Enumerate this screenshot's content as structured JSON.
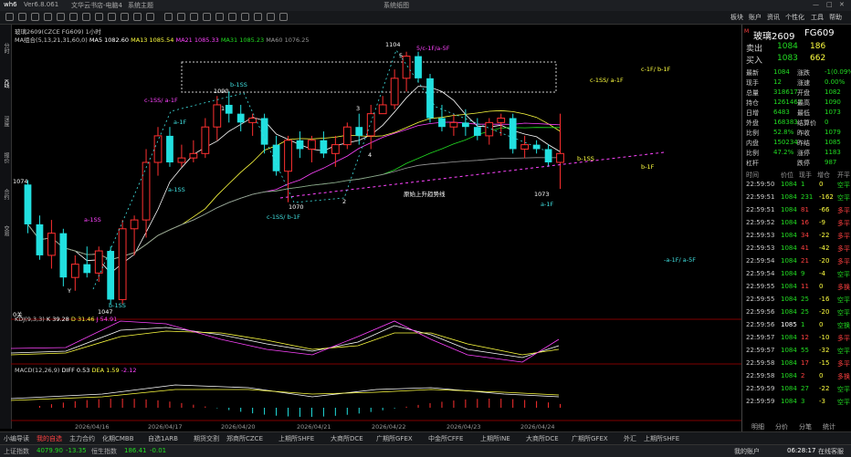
{
  "titlebar": {
    "logo": "wh6",
    "version": "Ver6.8.061",
    "menu": [
      "文华云书店-电脑4",
      "系统主题"
    ],
    "window_title": "系统纸图"
  },
  "toolbar": {
    "right_items": [
      "板块",
      "账户",
      "资讯",
      "个性化",
      "工具",
      "帮助"
    ]
  },
  "leftbar": {
    "items": [
      "分时",
      "K线",
      "深度",
      "报价",
      "合约",
      "交易"
    ]
  },
  "chart": {
    "title_line": "玻璃2609(CZCE FG609)   1小时",
    "ma_legend": [
      {
        "text": "MA组合(5,13,21,31,60,0)",
        "color": "#cccccc"
      },
      {
        "text": "MA5 1082.60",
        "color": "#ffffff"
      },
      {
        "text": "MA13 1085.54",
        "color": "#ffff40"
      },
      {
        "text": "MA21 1085.33",
        "color": "#ff44ff"
      },
      {
        "text": "MA31 1085.23",
        "color": "#22dd22"
      },
      {
        "text": "MA60 1076.25",
        "color": "#999999"
      }
    ],
    "price_labels": {
      "high": "1104",
      "low": "1047",
      "left_level": "1074",
      "mid_low": "1070",
      "right_low": "1073",
      "top_mid": "1090"
    },
    "wave_labels": [
      "c-1SS/ a-1F",
      "b-1SS",
      "a-1SS",
      "a-1SS",
      "b-1SS",
      "c-1SS/ b-1F",
      "5/c-1F/a-5F",
      "c-1SS/ a-1F",
      "c-1F/ b-1F",
      "b-1SS",
      "b-1F",
      "a-1F",
      "-a-1F/ a-5F",
      "a-1F",
      "原始上升趋势线",
      "Y",
      "1",
      "2",
      "3",
      "4",
      "5"
    ],
    "kdj_legend": {
      "name": "KDJ(9,3,3)",
      "k": "K 39.28",
      "d": "D 31.46",
      "j": "J 54.91"
    },
    "macd_legend": {
      "name": "MACD(12,26,9)",
      "diff": "DIFF 0.53",
      "dea": "DEA 1.59",
      "macd": "-2.12"
    },
    "vol_label": "0关",
    "dates": [
      "2026/04/16",
      "2026/04/17",
      "2026/04/20",
      "2026/04/21",
      "2026/04/22",
      "2026/04/23",
      "2026/04/24"
    ]
  },
  "chart_data": {
    "type": "candlestick",
    "title": "玻璃2609(CZCE FG609)",
    "ylim": [
      1045,
      1106
    ],
    "candles": [
      {
        "o": 1074,
        "h": 1075,
        "l": 1063,
        "c": 1065
      },
      {
        "o": 1065,
        "h": 1067,
        "l": 1057,
        "c": 1058
      },
      {
        "o": 1058,
        "h": 1066,
        "l": 1055,
        "c": 1063
      },
      {
        "o": 1063,
        "h": 1064,
        "l": 1051,
        "c": 1053
      },
      {
        "o": 1053,
        "h": 1058,
        "l": 1050,
        "c": 1056
      },
      {
        "o": 1056,
        "h": 1060,
        "l": 1053,
        "c": 1054
      },
      {
        "o": 1054,
        "h": 1060,
        "l": 1052,
        "c": 1059
      },
      {
        "o": 1059,
        "h": 1060,
        "l": 1047,
        "c": 1048
      },
      {
        "o": 1048,
        "h": 1066,
        "l": 1047,
        "c": 1064
      },
      {
        "o": 1064,
        "h": 1067,
        "l": 1058,
        "c": 1066
      },
      {
        "o": 1066,
        "h": 1082,
        "l": 1062,
        "c": 1079
      },
      {
        "o": 1079,
        "h": 1087,
        "l": 1076,
        "c": 1085
      },
      {
        "o": 1085,
        "h": 1087,
        "l": 1078,
        "c": 1079
      },
      {
        "o": 1079,
        "h": 1083,
        "l": 1078,
        "c": 1080
      },
      {
        "o": 1080,
        "h": 1084,
        "l": 1079,
        "c": 1081
      },
      {
        "o": 1081,
        "h": 1089,
        "l": 1080,
        "c": 1087
      },
      {
        "o": 1087,
        "h": 1094,
        "l": 1084,
        "c": 1092
      },
      {
        "o": 1092,
        "h": 1095,
        "l": 1088,
        "c": 1090
      },
      {
        "o": 1090,
        "h": 1092,
        "l": 1086,
        "c": 1088
      },
      {
        "o": 1088,
        "h": 1090,
        "l": 1085,
        "c": 1089
      },
      {
        "o": 1089,
        "h": 1090,
        "l": 1081,
        "c": 1083
      },
      {
        "o": 1083,
        "h": 1085,
        "l": 1076,
        "c": 1077
      },
      {
        "o": 1077,
        "h": 1085,
        "l": 1070,
        "c": 1084
      },
      {
        "o": 1084,
        "h": 1086,
        "l": 1080,
        "c": 1082
      },
      {
        "o": 1082,
        "h": 1085,
        "l": 1079,
        "c": 1084
      },
      {
        "o": 1084,
        "h": 1086,
        "l": 1080,
        "c": 1081
      },
      {
        "o": 1081,
        "h": 1085,
        "l": 1078,
        "c": 1083
      },
      {
        "o": 1083,
        "h": 1088,
        "l": 1082,
        "c": 1087
      },
      {
        "o": 1087,
        "h": 1090,
        "l": 1083,
        "c": 1085
      },
      {
        "o": 1085,
        "h": 1092,
        "l": 1082,
        "c": 1090
      },
      {
        "o": 1090,
        "h": 1094,
        "l": 1090,
        "c": 1092
      },
      {
        "o": 1092,
        "h": 1100,
        "l": 1091,
        "c": 1098
      },
      {
        "o": 1098,
        "h": 1104,
        "l": 1095,
        "c": 1103
      },
      {
        "o": 1103,
        "h": 1104,
        "l": 1097,
        "c": 1098
      },
      {
        "o": 1098,
        "h": 1099,
        "l": 1088,
        "c": 1089
      },
      {
        "o": 1089,
        "h": 1092,
        "l": 1086,
        "c": 1087
      },
      {
        "o": 1087,
        "h": 1090,
        "l": 1085,
        "c": 1088
      },
      {
        "o": 1088,
        "h": 1091,
        "l": 1085,
        "c": 1087
      },
      {
        "o": 1087,
        "h": 1089,
        "l": 1084,
        "c": 1085
      },
      {
        "o": 1085,
        "h": 1089,
        "l": 1083,
        "c": 1088
      },
      {
        "o": 1088,
        "h": 1090,
        "l": 1085,
        "c": 1089
      },
      {
        "o": 1089,
        "h": 1090,
        "l": 1081,
        "c": 1082
      },
      {
        "o": 1082,
        "h": 1085,
        "l": 1080,
        "c": 1083
      },
      {
        "o": 1083,
        "h": 1084,
        "l": 1081,
        "c": 1082
      },
      {
        "o": 1082,
        "h": 1083,
        "l": 1078,
        "c": 1079
      },
      {
        "o": 1079,
        "h": 1090,
        "l": 1073,
        "c": 1081
      }
    ]
  },
  "quote": {
    "header_name": "玻璃2609",
    "header_code": "FG609",
    "sell": {
      "label": "卖出",
      "price": "1084",
      "vol": "186"
    },
    "buy": {
      "label": "买入",
      "price": "1083",
      "vol": "662"
    },
    "stats": [
      [
        "最新",
        "1084",
        "涨跌",
        "-1(0.09%"
      ],
      [
        "现手",
        "12",
        "涨速",
        "0.00%"
      ],
      [
        "总量",
        "318617",
        "开盘",
        "1082"
      ],
      [
        "持仓",
        "1261467",
        "最高",
        "1090"
      ],
      [
        "日增",
        "6483",
        "最低",
        "1073"
      ],
      [
        "外盘",
        "168383",
        "结算价",
        "0"
      ],
      [
        "比例",
        "52.8%",
        "昨收",
        "1079"
      ],
      [
        "内盘",
        "150234",
        "昨结",
        "1085"
      ],
      [
        "比例",
        "47.2%",
        "涨停",
        "1183"
      ],
      [
        "杠杆",
        "",
        "跌停",
        "987"
      ]
    ],
    "ticks_header": [
      "时间",
      "价位",
      "现手",
      "增仓",
      "开平"
    ],
    "ticks": [
      [
        "22:59:50",
        "1084",
        "1",
        "0",
        "空平"
      ],
      [
        "22:59:51",
        "1084",
        "231",
        "-162",
        "空平"
      ],
      [
        "22:59:51",
        "1084",
        "81",
        "-66",
        "多平"
      ],
      [
        "22:59:52",
        "1084",
        "16",
        "-9",
        "多平"
      ],
      [
        "22:59:53",
        "1084",
        "34",
        "-22",
        "多平"
      ],
      [
        "22:59:53",
        "1084",
        "41",
        "-42",
        "多平"
      ],
      [
        "22:59:54",
        "1084",
        "21",
        "-20",
        "多平"
      ],
      [
        "22:59:54",
        "1084",
        "9",
        "-4",
        "空平"
      ],
      [
        "22:59:55",
        "1084",
        "11",
        "0",
        "多换"
      ],
      [
        "22:59:55",
        "1084",
        "25",
        "-16",
        "空平"
      ],
      [
        "22:59:56",
        "1084",
        "25",
        "-20",
        "空平"
      ],
      [
        "22:59:56",
        "1085",
        "1",
        "0",
        "空换"
      ],
      [
        "22:59:57",
        "1084",
        "12",
        "-10",
        "多平"
      ],
      [
        "22:59:57",
        "1084",
        "55",
        "-32",
        "空平"
      ],
      [
        "22:59:58",
        "1084",
        "17",
        "-15",
        "多平"
      ],
      [
        "22:59:58",
        "1084",
        "2",
        "0",
        "多换"
      ],
      [
        "22:59:59",
        "1084",
        "27",
        "-22",
        "空平"
      ],
      [
        "22:59:59",
        "1084",
        "3",
        "-3",
        "空平"
      ]
    ],
    "bottom_tabs": [
      "明细",
      "分价",
      "分笔",
      "统计"
    ]
  },
  "bottomtabs": [
    "小编导读",
    "我的自选",
    "主力合约",
    "化期CMBB",
    "自选1ARB",
    "期货交割",
    "郑商所CZCE",
    "上期所SHFE",
    "大商所DCE",
    "广期所GFEX",
    "中金所CFFE",
    "上期所INE",
    "大商所DCE",
    "广期所GFEX",
    "外汇",
    "上期所SHFE"
  ],
  "statusbar": {
    "left": "上证指数",
    "index1": "4079.90",
    "chg1": "-13.35",
    "left2": "恒生指数",
    "index2": "186.41",
    "chg2": "-0.01",
    "right_user": "我的账户",
    "time": "06:28:17",
    "online": "在线客服"
  }
}
